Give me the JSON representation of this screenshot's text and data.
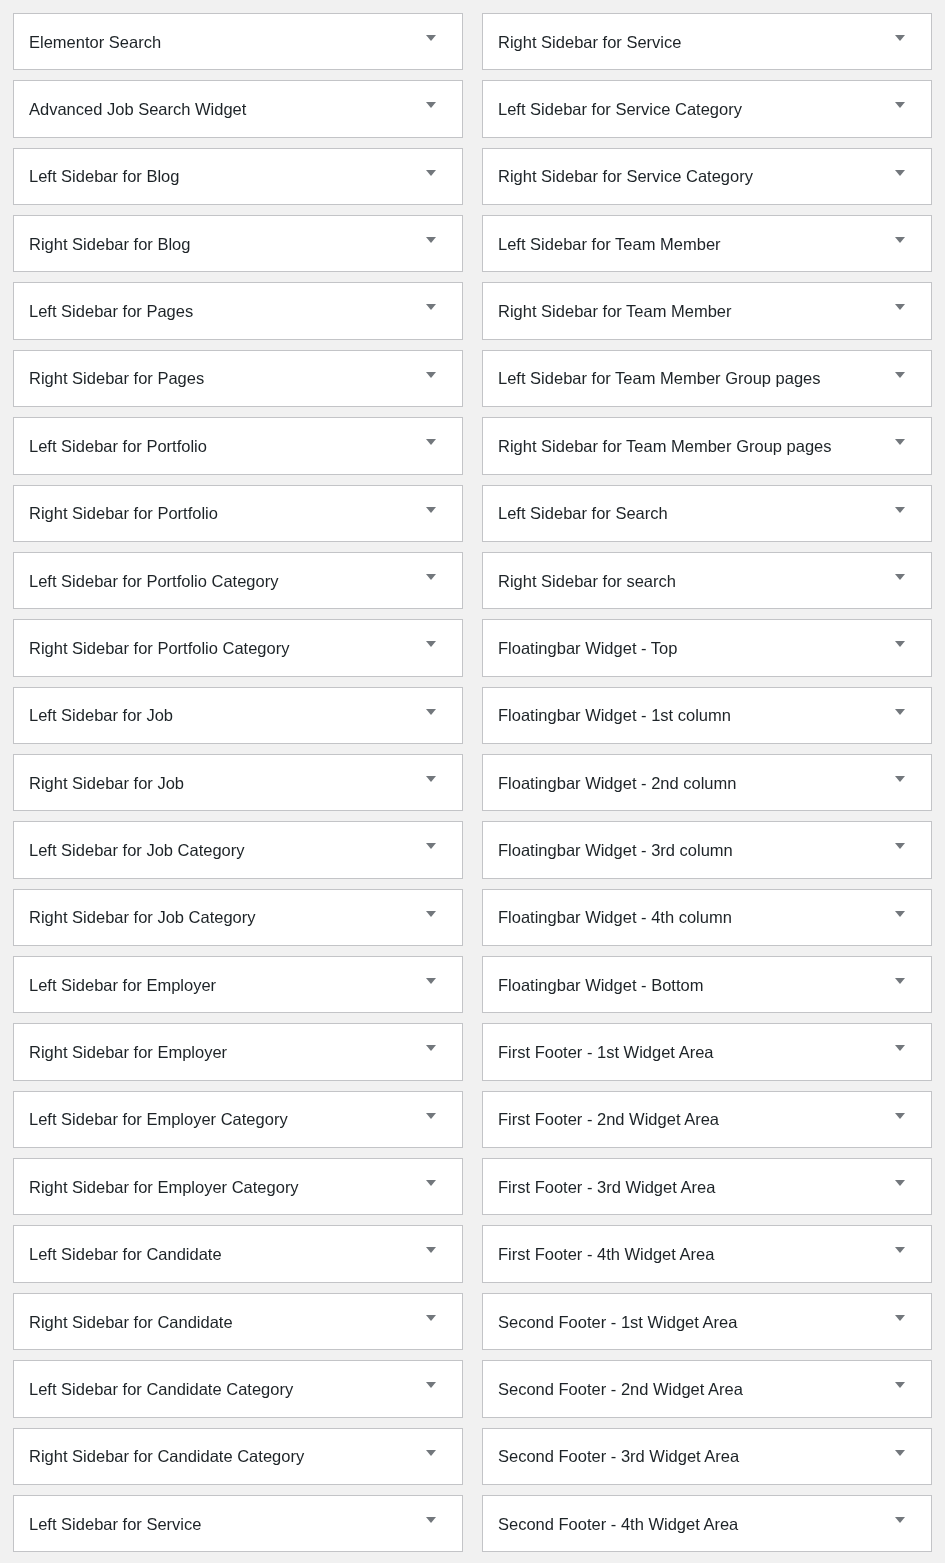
{
  "columns": [
    {
      "areas": [
        {
          "title": "Elementor Search",
          "expanded": false
        },
        {
          "title": "Advanced Job Search Widget",
          "expanded": false
        },
        {
          "title": "Left Sidebar for Blog",
          "expanded": false
        },
        {
          "title": "Right Sidebar for Blog",
          "expanded": false
        },
        {
          "title": "Left Sidebar for Pages",
          "expanded": false
        },
        {
          "title": "Right Sidebar for Pages",
          "expanded": false
        },
        {
          "title": "Left Sidebar for Portfolio",
          "expanded": false
        },
        {
          "title": "Right Sidebar for Portfolio",
          "expanded": false
        },
        {
          "title": "Left Sidebar for Portfolio Category",
          "expanded": false
        },
        {
          "title": "Right Sidebar for Portfolio Category",
          "expanded": false
        },
        {
          "title": "Left Sidebar for Job",
          "expanded": false
        },
        {
          "title": "Right Sidebar for Job",
          "expanded": false
        },
        {
          "title": "Left Sidebar for Job Category",
          "expanded": false
        },
        {
          "title": "Right Sidebar for Job Category",
          "expanded": false
        },
        {
          "title": "Left Sidebar for Employer",
          "expanded": false
        },
        {
          "title": "Right Sidebar for Employer",
          "expanded": false
        },
        {
          "title": "Left Sidebar for Employer Category",
          "expanded": false
        },
        {
          "title": "Right Sidebar for Employer Category",
          "expanded": false
        },
        {
          "title": "Left Sidebar for Candidate",
          "expanded": false
        },
        {
          "title": "Right Sidebar for Candidate",
          "expanded": false
        },
        {
          "title": "Left Sidebar for Candidate Category",
          "expanded": false
        },
        {
          "title": "Right Sidebar for Candidate Category",
          "expanded": false
        },
        {
          "title": "Left Sidebar for Service",
          "expanded": false
        }
      ]
    },
    {
      "areas": [
        {
          "title": "Right Sidebar for Service",
          "expanded": false
        },
        {
          "title": "Left Sidebar for Service Category",
          "expanded": false
        },
        {
          "title": "Right Sidebar for Service Category",
          "expanded": false
        },
        {
          "title": "Left Sidebar for Team Member",
          "expanded": false
        },
        {
          "title": "Right Sidebar for Team Member",
          "expanded": false
        },
        {
          "title": "Left Sidebar for Team Member Group pages",
          "expanded": false
        },
        {
          "title": "Right Sidebar for Team Member Group pages",
          "expanded": false
        },
        {
          "title": "Left Sidebar for Search",
          "expanded": false
        },
        {
          "title": "Right Sidebar for search",
          "expanded": false
        },
        {
          "title": "Floatingbar Widget - Top",
          "expanded": false
        },
        {
          "title": "Floatingbar Widget - 1st column",
          "expanded": false
        },
        {
          "title": "Floatingbar Widget - 2nd column",
          "expanded": false
        },
        {
          "title": "Floatingbar Widget - 3rd column",
          "expanded": false
        },
        {
          "title": "Floatingbar Widget - 4th column",
          "expanded": false
        },
        {
          "title": "Floatingbar Widget - Bottom",
          "expanded": false
        },
        {
          "title": "First Footer - 1st Widget Area",
          "expanded": false
        },
        {
          "title": "First Footer - 2nd Widget Area",
          "expanded": false
        },
        {
          "title": "First Footer - 3rd Widget Area",
          "expanded": false
        },
        {
          "title": "First Footer - 4th Widget Area",
          "expanded": false
        },
        {
          "title": "Second Footer - 1st Widget Area",
          "expanded": false
        },
        {
          "title": "Second Footer - 2nd Widget Area",
          "expanded": false
        },
        {
          "title": "Second Footer - 3rd Widget Area",
          "expanded": false
        },
        {
          "title": "Second Footer - 4th Widget Area",
          "expanded": false
        }
      ]
    }
  ]
}
